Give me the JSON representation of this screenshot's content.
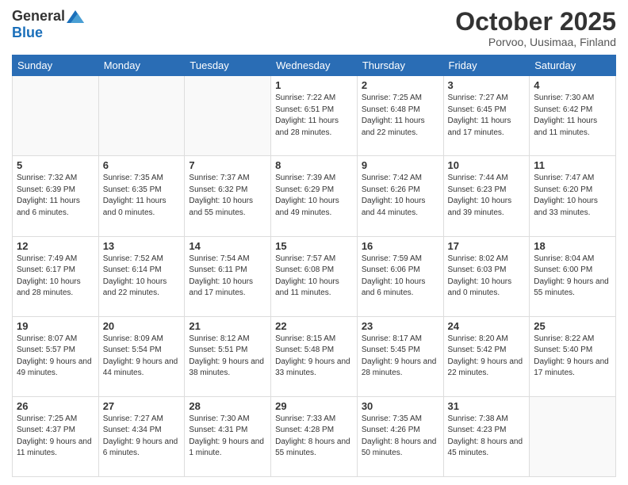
{
  "header": {
    "logo_general": "General",
    "logo_blue": "Blue",
    "month_title": "October 2025",
    "location": "Porvoo, Uusimaa, Finland"
  },
  "days_of_week": [
    "Sunday",
    "Monday",
    "Tuesday",
    "Wednesday",
    "Thursday",
    "Friday",
    "Saturday"
  ],
  "weeks": [
    [
      {
        "day": "",
        "info": ""
      },
      {
        "day": "",
        "info": ""
      },
      {
        "day": "",
        "info": ""
      },
      {
        "day": "1",
        "info": "Sunrise: 7:22 AM\nSunset: 6:51 PM\nDaylight: 11 hours\nand 28 minutes."
      },
      {
        "day": "2",
        "info": "Sunrise: 7:25 AM\nSunset: 6:48 PM\nDaylight: 11 hours\nand 22 minutes."
      },
      {
        "day": "3",
        "info": "Sunrise: 7:27 AM\nSunset: 6:45 PM\nDaylight: 11 hours\nand 17 minutes."
      },
      {
        "day": "4",
        "info": "Sunrise: 7:30 AM\nSunset: 6:42 PM\nDaylight: 11 hours\nand 11 minutes."
      }
    ],
    [
      {
        "day": "5",
        "info": "Sunrise: 7:32 AM\nSunset: 6:39 PM\nDaylight: 11 hours\nand 6 minutes."
      },
      {
        "day": "6",
        "info": "Sunrise: 7:35 AM\nSunset: 6:35 PM\nDaylight: 11 hours\nand 0 minutes."
      },
      {
        "day": "7",
        "info": "Sunrise: 7:37 AM\nSunset: 6:32 PM\nDaylight: 10 hours\nand 55 minutes."
      },
      {
        "day": "8",
        "info": "Sunrise: 7:39 AM\nSunset: 6:29 PM\nDaylight: 10 hours\nand 49 minutes."
      },
      {
        "day": "9",
        "info": "Sunrise: 7:42 AM\nSunset: 6:26 PM\nDaylight: 10 hours\nand 44 minutes."
      },
      {
        "day": "10",
        "info": "Sunrise: 7:44 AM\nSunset: 6:23 PM\nDaylight: 10 hours\nand 39 minutes."
      },
      {
        "day": "11",
        "info": "Sunrise: 7:47 AM\nSunset: 6:20 PM\nDaylight: 10 hours\nand 33 minutes."
      }
    ],
    [
      {
        "day": "12",
        "info": "Sunrise: 7:49 AM\nSunset: 6:17 PM\nDaylight: 10 hours\nand 28 minutes."
      },
      {
        "day": "13",
        "info": "Sunrise: 7:52 AM\nSunset: 6:14 PM\nDaylight: 10 hours\nand 22 minutes."
      },
      {
        "day": "14",
        "info": "Sunrise: 7:54 AM\nSunset: 6:11 PM\nDaylight: 10 hours\nand 17 minutes."
      },
      {
        "day": "15",
        "info": "Sunrise: 7:57 AM\nSunset: 6:08 PM\nDaylight: 10 hours\nand 11 minutes."
      },
      {
        "day": "16",
        "info": "Sunrise: 7:59 AM\nSunset: 6:06 PM\nDaylight: 10 hours\nand 6 minutes."
      },
      {
        "day": "17",
        "info": "Sunrise: 8:02 AM\nSunset: 6:03 PM\nDaylight: 10 hours\nand 0 minutes."
      },
      {
        "day": "18",
        "info": "Sunrise: 8:04 AM\nSunset: 6:00 PM\nDaylight: 9 hours\nand 55 minutes."
      }
    ],
    [
      {
        "day": "19",
        "info": "Sunrise: 8:07 AM\nSunset: 5:57 PM\nDaylight: 9 hours\nand 49 minutes."
      },
      {
        "day": "20",
        "info": "Sunrise: 8:09 AM\nSunset: 5:54 PM\nDaylight: 9 hours\nand 44 minutes."
      },
      {
        "day": "21",
        "info": "Sunrise: 8:12 AM\nSunset: 5:51 PM\nDaylight: 9 hours\nand 38 minutes."
      },
      {
        "day": "22",
        "info": "Sunrise: 8:15 AM\nSunset: 5:48 PM\nDaylight: 9 hours\nand 33 minutes."
      },
      {
        "day": "23",
        "info": "Sunrise: 8:17 AM\nSunset: 5:45 PM\nDaylight: 9 hours\nand 28 minutes."
      },
      {
        "day": "24",
        "info": "Sunrise: 8:20 AM\nSunset: 5:42 PM\nDaylight: 9 hours\nand 22 minutes."
      },
      {
        "day": "25",
        "info": "Sunrise: 8:22 AM\nSunset: 5:40 PM\nDaylight: 9 hours\nand 17 minutes."
      }
    ],
    [
      {
        "day": "26",
        "info": "Sunrise: 7:25 AM\nSunset: 4:37 PM\nDaylight: 9 hours\nand 11 minutes."
      },
      {
        "day": "27",
        "info": "Sunrise: 7:27 AM\nSunset: 4:34 PM\nDaylight: 9 hours\nand 6 minutes."
      },
      {
        "day": "28",
        "info": "Sunrise: 7:30 AM\nSunset: 4:31 PM\nDaylight: 9 hours\nand 1 minute."
      },
      {
        "day": "29",
        "info": "Sunrise: 7:33 AM\nSunset: 4:28 PM\nDaylight: 8 hours\nand 55 minutes."
      },
      {
        "day": "30",
        "info": "Sunrise: 7:35 AM\nSunset: 4:26 PM\nDaylight: 8 hours\nand 50 minutes."
      },
      {
        "day": "31",
        "info": "Sunrise: 7:38 AM\nSunset: 4:23 PM\nDaylight: 8 hours\nand 45 minutes."
      },
      {
        "day": "",
        "info": ""
      }
    ]
  ]
}
